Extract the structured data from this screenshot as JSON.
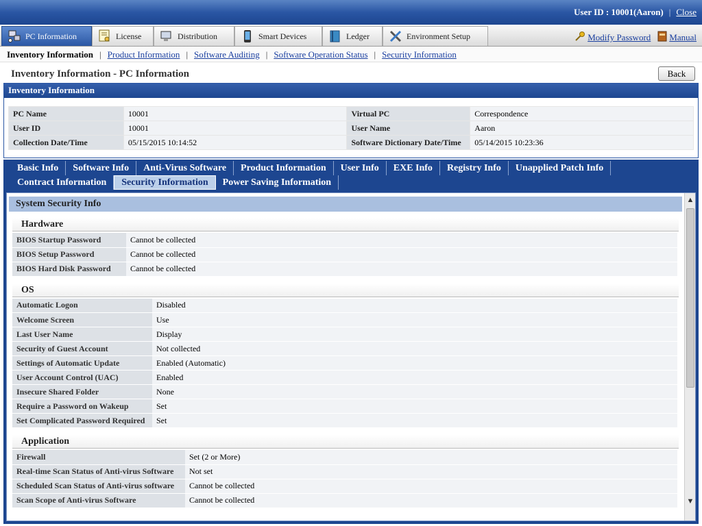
{
  "topbar": {
    "user_id": "User ID : 10001(Aaron)",
    "close_label": "Close"
  },
  "menu": {
    "tabs": [
      {
        "label": "PC Information",
        "icon": "pc-network-icon",
        "active": true
      },
      {
        "label": "License",
        "icon": "license-certificate-icon"
      },
      {
        "label": "Distribution",
        "icon": "distribution-computer-icon"
      },
      {
        "label": "Smart Devices",
        "icon": "smartphone-icon"
      },
      {
        "label": "Ledger",
        "icon": "ledger-book-icon"
      },
      {
        "label": "Environment Setup",
        "icon": "tools-icon"
      }
    ],
    "modify_password": "Modify Password",
    "manual": "Manual"
  },
  "subnav": {
    "current": "Inventory Information",
    "links": [
      "Product Information",
      "Software Auditing",
      "Software Operation Status",
      "Security Information"
    ]
  },
  "page": {
    "title": "Inventory Information - PC Information",
    "back_label": "Back"
  },
  "inventory": {
    "header": "Inventory Information",
    "rows": [
      {
        "l1": "PC Name",
        "v1": "10001",
        "l2": "Virtual PC",
        "v2": "Correspondence"
      },
      {
        "l1": "User ID",
        "v1": "10001",
        "l2": "User Name",
        "v2": "Aaron"
      },
      {
        "l1": "Collection Date/Time",
        "v1": "05/15/2015 10:14:52",
        "l2": "Software Dictionary Date/Time",
        "v2": "05/14/2015 10:23:36"
      }
    ]
  },
  "detail_tabs": {
    "row1": [
      "Basic Info",
      "Software Info",
      "Anti-Virus Software",
      "Product Information",
      "User Info",
      "EXE Info",
      "Registry Info",
      "Unapplied Patch Info"
    ],
    "row2": [
      "Contract Information",
      "Security Information",
      "Power Saving Information"
    ],
    "active": "Security Information"
  },
  "security": {
    "header": "System Security Info",
    "groups": [
      {
        "title": "Hardware",
        "rows": [
          {
            "label": "BIOS Startup Password",
            "value": "Cannot be collected"
          },
          {
            "label": "BIOS Setup Password",
            "value": "Cannot be collected"
          },
          {
            "label": "BIOS Hard Disk Password",
            "value": "Cannot be collected"
          }
        ]
      },
      {
        "title": "OS",
        "rows": [
          {
            "label": "Automatic Logon",
            "value": "Disabled"
          },
          {
            "label": "Welcome Screen",
            "value": "Use"
          },
          {
            "label": "Last User Name",
            "value": "Display"
          },
          {
            "label": "Security of Guest Account",
            "value": "Not collected"
          },
          {
            "label": "Settings of Automatic Update",
            "value": "Enabled (Automatic)"
          },
          {
            "label": "User Account Control (UAC)",
            "value": "Enabled"
          },
          {
            "label": "Insecure Shared Folder",
            "value": "None"
          },
          {
            "label": "Require a Password on Wakeup",
            "value": "Set"
          },
          {
            "label": "Set Complicated Password Required",
            "value": "Set"
          }
        ]
      },
      {
        "title": "Application",
        "rows": [
          {
            "label": "Firewall",
            "value": "Set (2 or More)"
          },
          {
            "label": "Real-time Scan Status of Anti-virus Software",
            "value": "Not set"
          },
          {
            "label": "Scheduled Scan Status of Anti-virus software",
            "value": "Cannot be collected"
          },
          {
            "label": "Scan Scope of Anti-virus Software",
            "value": "Cannot be collected"
          }
        ]
      }
    ]
  },
  "colors": {
    "header_blue": "#1d4690",
    "label_gray": "#dde1e6",
    "value_gray": "#f1f3f6",
    "link": "#1a3fa0"
  }
}
